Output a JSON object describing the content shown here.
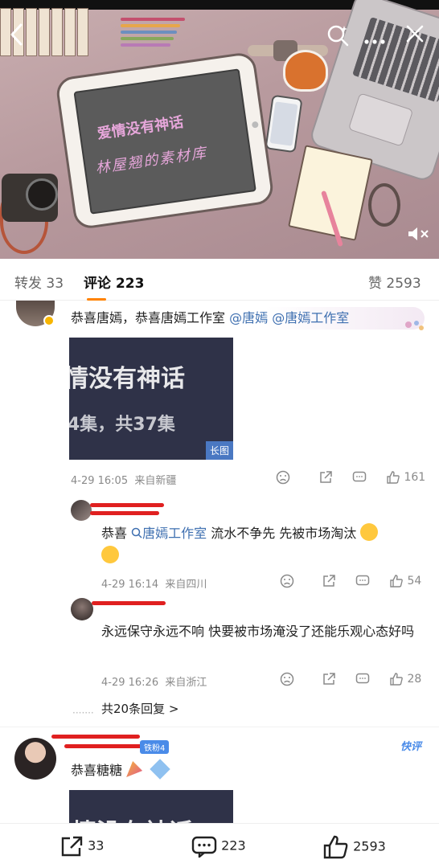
{
  "header": {
    "back_icon": "chevron-left-icon",
    "search_icon": "search-sparkle-icon",
    "more_icon": "more-dots-icon",
    "close_icon": "close-icon",
    "mute_icon": "speaker-mute-icon"
  },
  "hero": {
    "title": "爱情没有神话",
    "subtitle": "林屋翘的素材库"
  },
  "tabs": {
    "repost_label": "转发 33",
    "comments_label": "评论 223",
    "likes_label": "赞 2593"
  },
  "comments": [
    {
      "text_parts": [
        "恭喜唐嫣，恭喜唐嫣工作室 ",
        "@唐嫣",
        " ",
        "@唐嫣工作室"
      ],
      "image": {
        "line1": "情没有神话",
        "line2": "4集，共37集",
        "badge": "长图"
      },
      "time": "4-29 16:05",
      "location": "来自新疆",
      "likes": "161"
    }
  ],
  "replies": [
    {
      "text_prefix": "恭喜",
      "mention": "唐嫣工作室",
      "text_suffix": "流水不争先 先被市场淘汰",
      "time": "4-29 16:14",
      "location": "来自四川",
      "likes": "54"
    },
    {
      "text": "永远保守永远不响 快要被市场淹没了还能乐观心态好吗",
      "time": "4-29 16:26",
      "location": "来自浙江",
      "likes": "28"
    }
  ],
  "more_replies": "共20条回复 >",
  "comment3": {
    "badge": "铁粉4",
    "text": "恭喜糖糖",
    "tag": "快评",
    "image_line": "情没有神话"
  },
  "bottom": {
    "repost_count": "33",
    "comment_count": "223",
    "like_count": "2593"
  },
  "colors": {
    "accent": "#ff8200",
    "link": "#3e6fb0",
    "redaction": "#e02020"
  }
}
